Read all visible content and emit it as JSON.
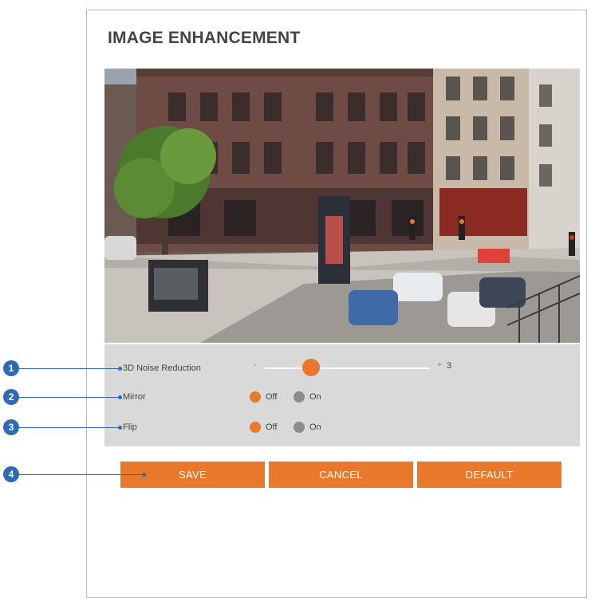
{
  "title": "IMAGE ENHANCEMENT",
  "settings": {
    "noise_reduction": {
      "label": "3D Noise Reduction",
      "minus": "-",
      "plus": "+",
      "value": "3",
      "level_fraction": 0.28
    },
    "mirror": {
      "label": "Mirror",
      "options": [
        "Off",
        "On"
      ],
      "selected": "Off"
    },
    "flip": {
      "label": "Flip",
      "options": [
        "Off",
        "On"
      ],
      "selected": "Off"
    }
  },
  "buttons": {
    "save": "SAVE",
    "cancel": "CANCEL",
    "default": "DEFAULT"
  },
  "callouts": [
    "1",
    "2",
    "3",
    "4"
  ],
  "colors": {
    "accent": "#e8782b",
    "callout": "#2f6bb5",
    "panel_bg": "#d9d9d9",
    "radio_off": "#8c8c8c"
  }
}
